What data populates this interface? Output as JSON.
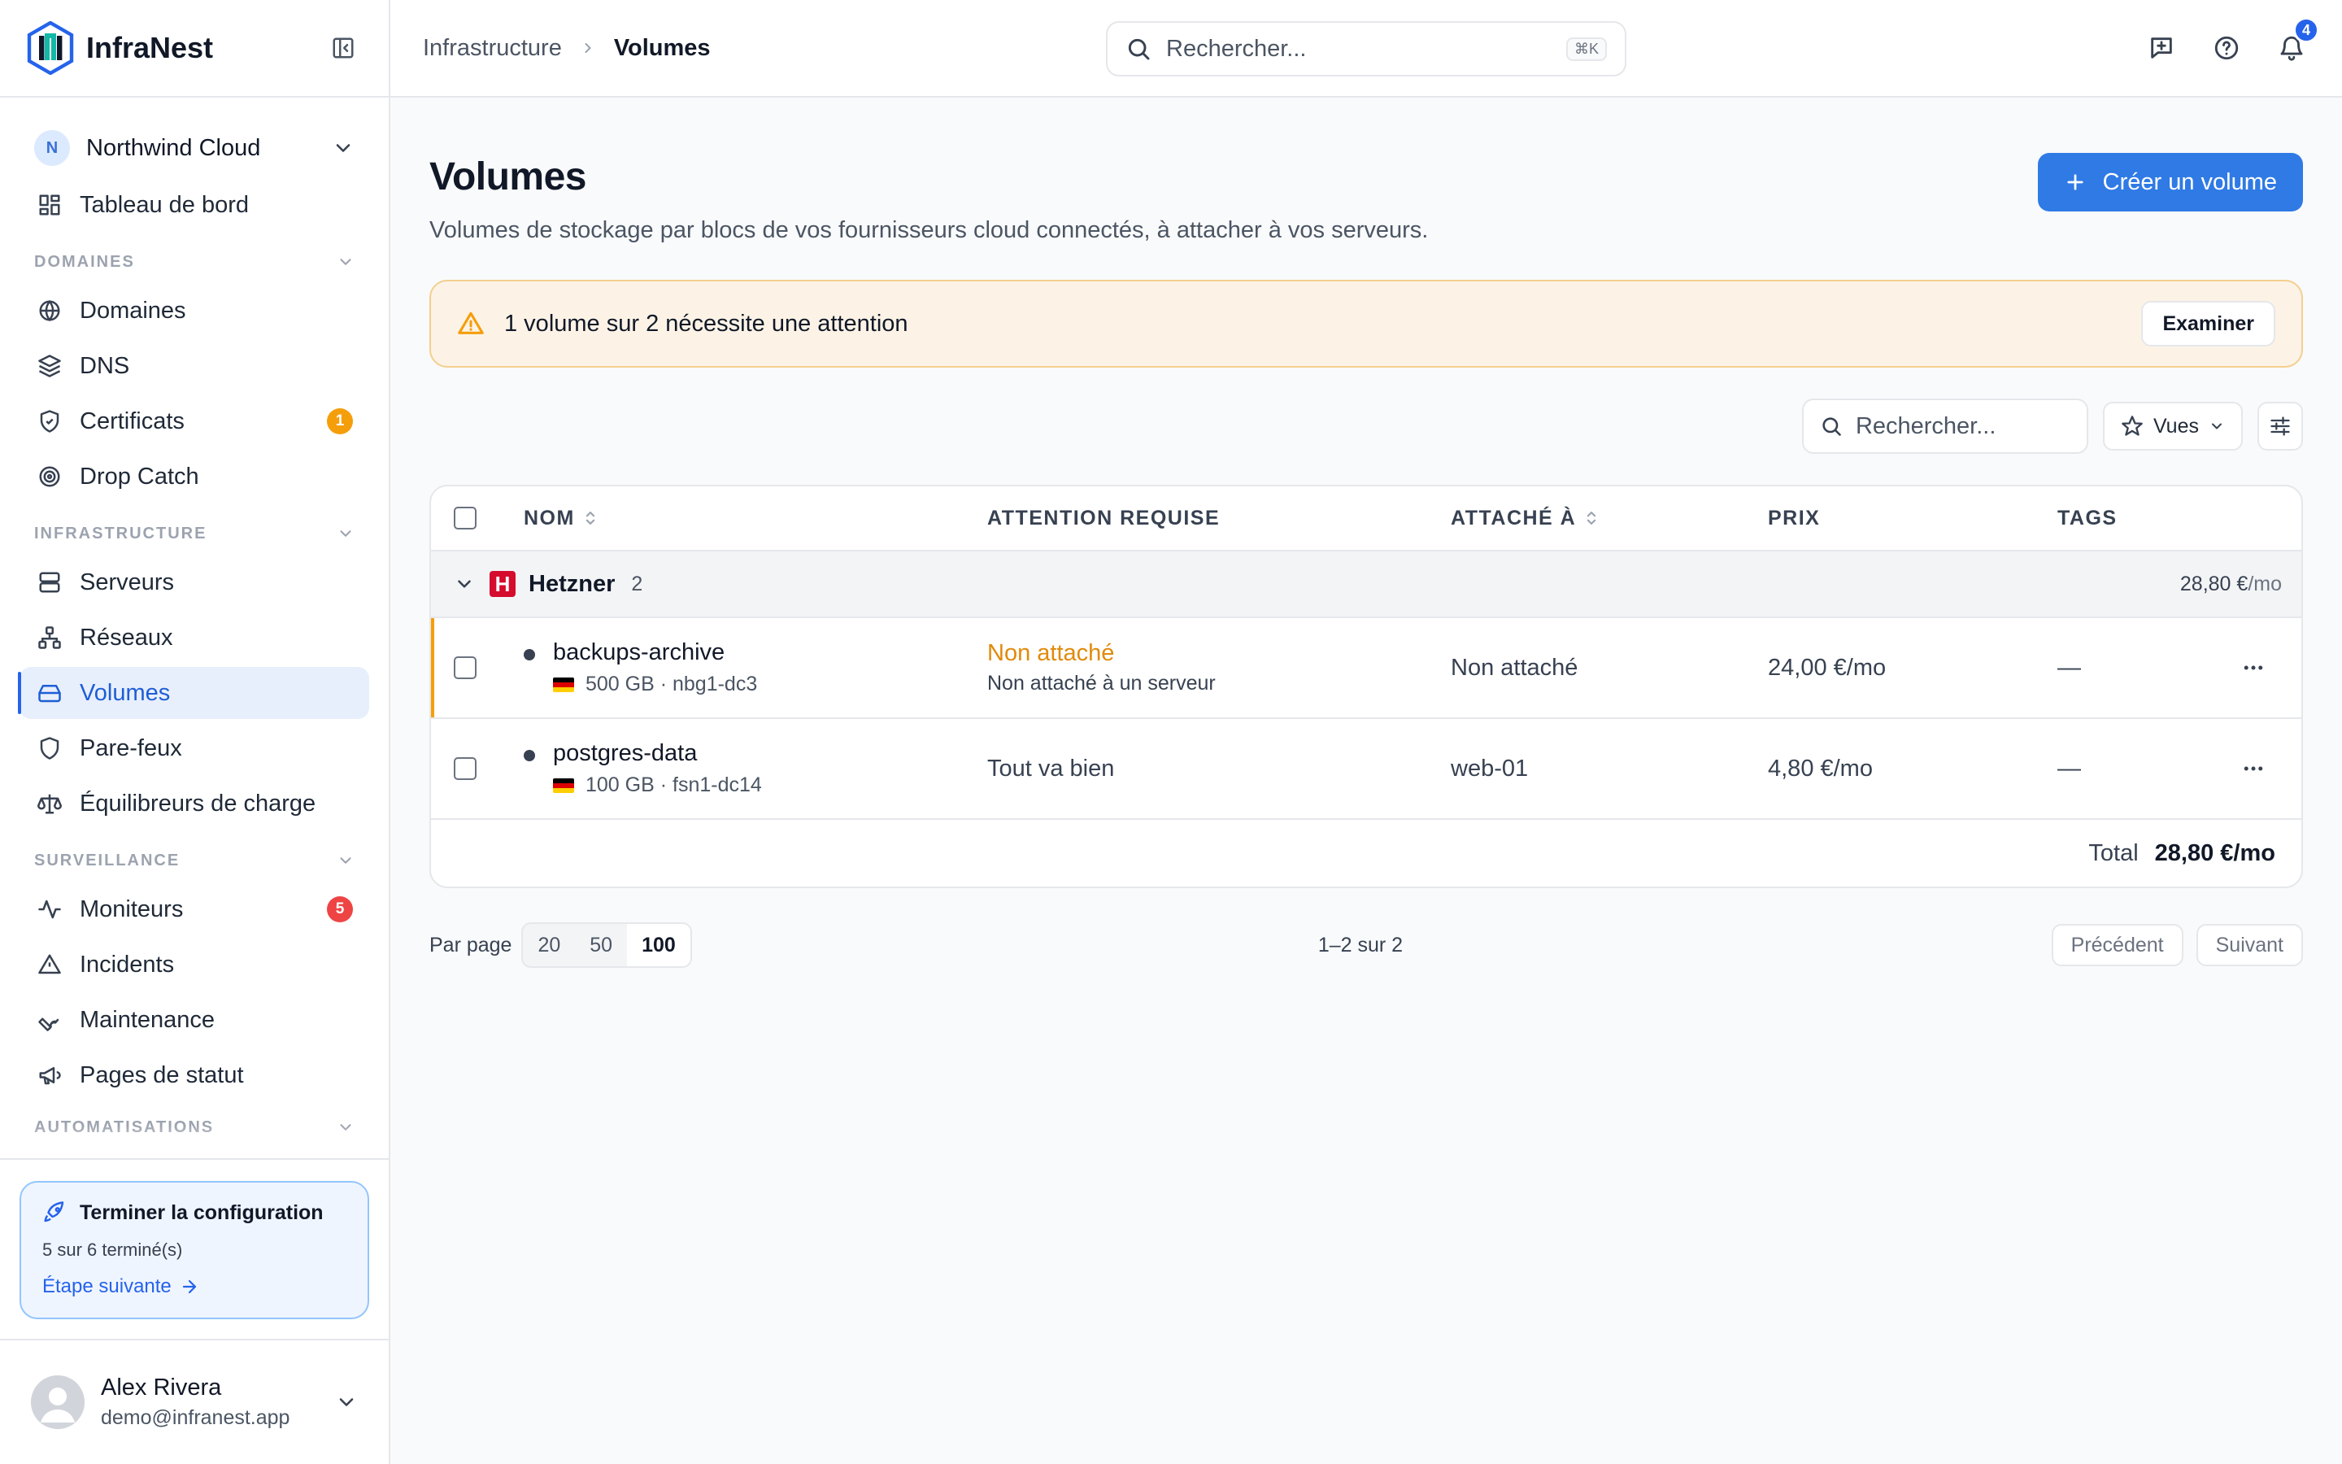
{
  "brand": {
    "name": "InfraNest"
  },
  "org": {
    "initial": "N",
    "name": "Northwind Cloud"
  },
  "nav": {
    "dashboard": "Tableau de bord",
    "sections": {
      "domains": "DOMAINES",
      "infrastructure": "INFRASTRUCTURE",
      "monitoring": "SURVEILLANCE",
      "automations": "AUTOMATISATIONS"
    },
    "domains": "Domaines",
    "dns": "DNS",
    "certificates": "Certificats",
    "certificates_badge": "1",
    "drop_catch": "Drop Catch",
    "servers": "Serveurs",
    "networks": "Réseaux",
    "volumes": "Volumes",
    "firewalls": "Pare-feux",
    "load_balancers": "Équilibreurs de charge",
    "monitors": "Moniteurs",
    "monitors_badge": "5",
    "incidents": "Incidents",
    "maintenance": "Maintenance",
    "status_pages": "Pages de statut"
  },
  "setup": {
    "title": "Terminer la configuration",
    "progress": "5 sur 6 terminé(s)",
    "next": "Étape suivante"
  },
  "user": {
    "name": "Alex Rivera",
    "email": "demo@infranest.app"
  },
  "topbar": {
    "breadcrumb_parent": "Infrastructure",
    "breadcrumb_current": "Volumes",
    "search_placeholder": "Rechercher...",
    "search_shortcut": "⌘K",
    "notifications_count": "4"
  },
  "page": {
    "title": "Volumes",
    "description": "Volumes de stockage par blocs de vos fournisseurs cloud connectés, à attacher à vos serveurs.",
    "create_label": "Créer un volume"
  },
  "alert": {
    "text": "1 volume sur 2 nécessite une attention",
    "action": "Examiner"
  },
  "toolbar": {
    "search_placeholder": "Rechercher...",
    "views_label": "Vues"
  },
  "table": {
    "columns": {
      "name": "NOM",
      "attention": "ATTENTION REQUISE",
      "attached": "ATTACHÉ À",
      "price": "PRIX",
      "tags": "TAGS"
    },
    "group": {
      "logo_letter": "H",
      "name": "Hetzner",
      "count": "2",
      "total": "28,80 €",
      "total_unit": "/mo"
    },
    "rows": [
      {
        "name": "backups-archive",
        "meta": "500 GB · nbg1-dc3",
        "attention": "Non attaché",
        "attention_sub": "Non attaché à un serveur",
        "attached": "Non attaché",
        "price": "24,00 €/mo",
        "tags": "—"
      },
      {
        "name": "postgres-data",
        "meta": "100 GB · fsn1-dc14",
        "attention": "Tout va bien",
        "attached": "web-01",
        "price": "4,80 €/mo",
        "tags": "—"
      }
    ],
    "footer_label": "Total",
    "footer_value": "28,80 €/mo"
  },
  "pagination": {
    "per_page_label": "Par page",
    "options": [
      "20",
      "50",
      "100"
    ],
    "range": "1–2 sur 2",
    "prev": "Précédent",
    "next": "Suivant"
  },
  "colors": {
    "accent": "#2f7ae5",
    "warning": "#f59e0b",
    "danger": "#ef4444",
    "hetzner": "#d50c2d"
  }
}
